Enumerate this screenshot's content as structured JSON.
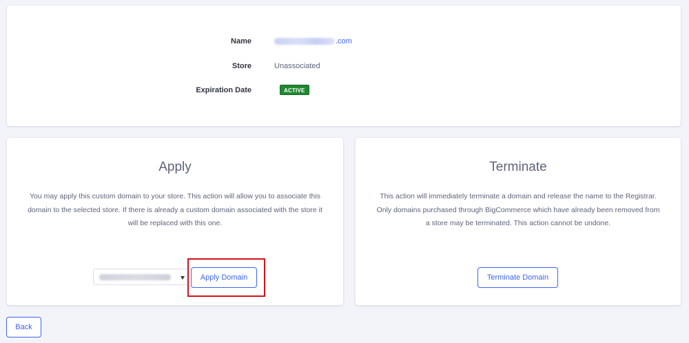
{
  "domain_info": {
    "name_label": "Name",
    "name_value_suffix": ".com",
    "store_label": "Store",
    "store_value": "Unassociated",
    "expiration_label": "Expiration Date",
    "status_badge": "ACTIVE"
  },
  "apply": {
    "title": "Apply",
    "description": "You may apply this custom domain to your store. This action will allow you to associate this domain to the selected store. If there is already a custom domain associated with the store it will be replaced with this one.",
    "button_label": "Apply Domain"
  },
  "terminate": {
    "title": "Terminate",
    "description": "This action will immediately terminate a domain and release the name to the Registrar. Only domains purchased through BigCommerce which have already been removed from a store may be terminated. This action cannot be undone.",
    "button_label": "Terminate Domain"
  },
  "back_label": "Back",
  "colors": {
    "accent": "#3c64f4",
    "active_badge": "#208831",
    "highlight": "#d0121b",
    "background": "#f2f4fa"
  }
}
